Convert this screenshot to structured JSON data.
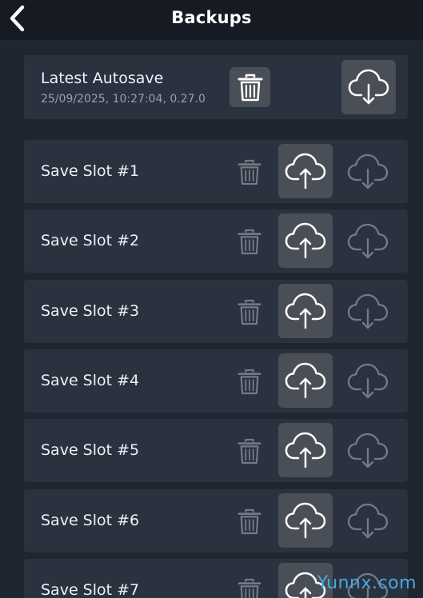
{
  "header": {
    "title": "Backups",
    "back_icon": "chevron-left-icon"
  },
  "autosave": {
    "title": "Latest Autosave",
    "subtitle": "25/09/2025, 10:27:04, 0.27.0",
    "delete_icon": "trash-icon",
    "download_icon": "cloud-download-icon"
  },
  "slots": [
    {
      "label": "Save Slot #1"
    },
    {
      "label": "Save Slot #2"
    },
    {
      "label": "Save Slot #3"
    },
    {
      "label": "Save Slot #4"
    },
    {
      "label": "Save Slot #5"
    },
    {
      "label": "Save Slot #6"
    },
    {
      "label": "Save Slot #7"
    }
  ],
  "watermark": "Yunnx.com",
  "colors": {
    "background": "#1f2630",
    "header": "#161b23",
    "card": "#2a3240",
    "active_button": "#4a4f57",
    "dim_icon": "#737b86",
    "watermark": "#47a8e0"
  }
}
